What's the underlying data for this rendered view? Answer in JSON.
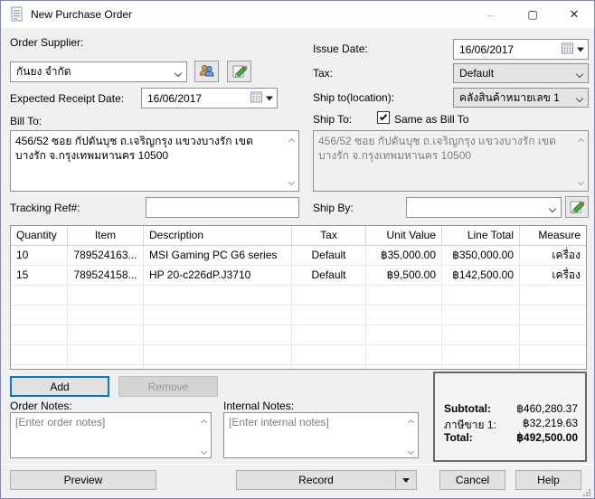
{
  "window": {
    "title": "New Purchase Order",
    "controls": {
      "minimize": "–",
      "maximize": "▢",
      "close": "✕"
    }
  },
  "colors": {
    "accent_focus": "#0078d7",
    "window_border": "#7e84c8",
    "titlebar_bg": "#ffffff",
    "dialog_bg": "#f0f0f0"
  },
  "icons": {
    "titlebar": "document-icon",
    "supplier_lookup": "people-icon",
    "edit": "pencil-icon",
    "date_picker": "calendar-icon",
    "dropdown": "chevron-down-icon",
    "record_menu": "down-triangle-icon"
  },
  "form": {
    "order_supplier": {
      "label": "Order Supplier:",
      "value": "กันยง จำกัด"
    },
    "expected_receipt_date": {
      "label": "Expected Receipt Date:",
      "value": "16/06/2017"
    },
    "issue_date": {
      "label": "Issue Date:",
      "value": "16/06/2017"
    },
    "tax": {
      "label": "Tax:",
      "value": "Default"
    },
    "ship_to_location": {
      "label": "Ship to(location):",
      "value": "คลังสินค้าหมายเลข 1"
    },
    "ship_to": {
      "label": "Ship To:",
      "checkbox_label": "Same as Bill To",
      "checked": true
    },
    "bill_to": {
      "label": "Bill To:",
      "value": "456/52 ซอย กัปตันบุช ถ.เจริญกรุง แขวงบางรัก เขตบางรัก จ.กรุงเทพมหานคร 10500"
    },
    "ship_to_address": {
      "value": "456/52 ซอย กัปตันบุช ถ.เจริญกรุง แขวงบางรัก เขตบางรัก จ.กรุงเทพมหานคร 10500"
    },
    "tracking_ref": {
      "label": "Tracking Ref#:",
      "value": ""
    },
    "ship_by": {
      "label": "Ship By:",
      "value": ""
    }
  },
  "items_table": {
    "columns": [
      "Quantity",
      "Item",
      "Description",
      "Tax",
      "Unit Value",
      "Line Total",
      "Measure"
    ],
    "rows": [
      [
        "10",
        "789524163...",
        "MSI Gaming PC G6 series",
        "Default",
        "฿35,000.00",
        "฿350,000.00",
        "เครื่อง"
      ],
      [
        "15",
        "789524158...",
        "HP 20-c226dP.J3710",
        "Default",
        "฿9,500.00",
        "฿142,500.00",
        "เครื่อง"
      ]
    ],
    "add_label": "Add",
    "remove_label": "Remove"
  },
  "notes": {
    "order_notes_label": "Order Notes:",
    "order_notes_placeholder": "[Enter order notes]",
    "internal_notes_label": "Internal Notes:",
    "internal_notes_placeholder": "[Enter internal notes]"
  },
  "totals": {
    "subtotal_label": "Subtotal:",
    "subtotal_value": "฿460,280.37",
    "tax_label": "ภาษีขาย 1:",
    "tax_value": "฿32,219.63",
    "total_label": "Total:",
    "total_value": "฿492,500.00"
  },
  "footer": {
    "preview": "Preview",
    "record": "Record",
    "cancel": "Cancel",
    "help": "Help"
  }
}
